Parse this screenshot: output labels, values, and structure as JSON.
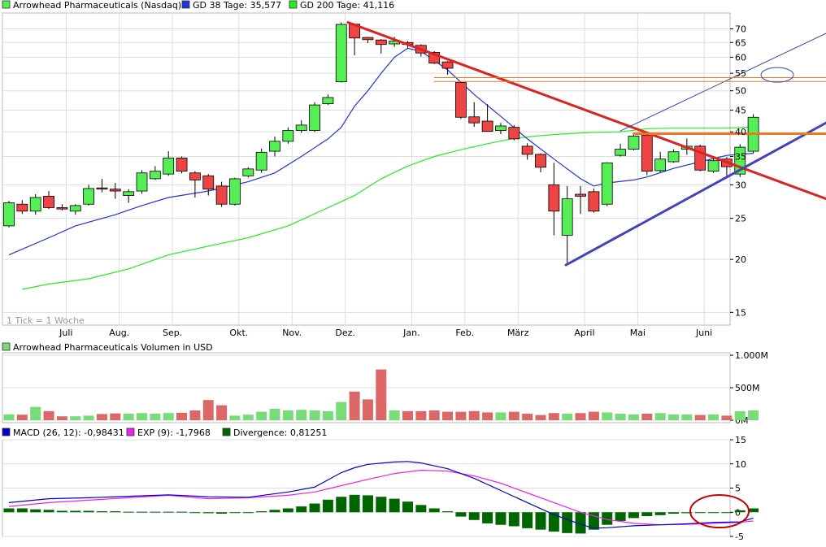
{
  "colors": {
    "up": "#55ee55",
    "down": "#ee4444",
    "gd38": "#2233dd",
    "gd200": "#22ee22",
    "grid": "#dddddd",
    "resistance": "#dd2222",
    "support": "#4444bb",
    "horizontal": "#ee7722",
    "channel": "#3344bb",
    "volume_up": "#77dd77",
    "volume_down": "#dd6666",
    "macd": "#0000cc",
    "exp": "#ee22ee",
    "divergence": "#006600",
    "highlight": "#cc0000"
  },
  "chart_data": [
    {
      "type": "candlestick",
      "legend": [
        {
          "label": "Arrowhead Pharmaceuticals (Nasdaq)",
          "color": "#55ee55"
        },
        {
          "label": "GD 38 Tage: 35,577",
          "color": "#2233dd"
        },
        {
          "label": "GD 200 Tage: 41,116",
          "color": "#22ee22"
        }
      ],
      "scale": "log",
      "ylim": [
        14.5,
        73
      ],
      "y_ticks": [
        15,
        20,
        25,
        30,
        35,
        40,
        45,
        50,
        55,
        60,
        65,
        70
      ],
      "x_labels": [
        "Juli",
        "Aug.",
        "Sep.",
        "Okt.",
        "Nov.",
        "Dez.",
        "Jan.",
        "Feb.",
        "März",
        "April",
        "Mai",
        "Juni"
      ],
      "x_label_weeks": [
        4.3,
        8.3,
        12.3,
        17.3,
        21.3,
        25.3,
        30.3,
        34.3,
        38.3,
        43.3,
        47.3,
        52.3
      ],
      "note": "1 Tick = 1 Woche",
      "candles": [
        {
          "o": 24.0,
          "h": 27.5,
          "l": 23.8,
          "c": 27.2
        },
        {
          "o": 27.0,
          "h": 27.6,
          "l": 25.6,
          "c": 26.0
        },
        {
          "o": 26.0,
          "h": 28.5,
          "l": 25.5,
          "c": 28.0
        },
        {
          "o": 28.2,
          "h": 29.0,
          "l": 26.3,
          "c": 26.5
        },
        {
          "o": 26.5,
          "h": 27.0,
          "l": 26.1,
          "c": 26.3
        },
        {
          "o": 26.0,
          "h": 27.0,
          "l": 25.5,
          "c": 26.8
        },
        {
          "o": 27.0,
          "h": 30.0,
          "l": 26.8,
          "c": 29.4
        },
        {
          "o": 29.5,
          "h": 31.0,
          "l": 28.8,
          "c": 29.3
        },
        {
          "o": 29.3,
          "h": 30.3,
          "l": 27.8,
          "c": 29.0
        },
        {
          "o": 28.3,
          "h": 29.3,
          "l": 27.2,
          "c": 28.9
        },
        {
          "o": 29.0,
          "h": 32.5,
          "l": 28.6,
          "c": 32.0
        },
        {
          "o": 31.0,
          "h": 33.2,
          "l": 30.8,
          "c": 32.3
        },
        {
          "o": 31.8,
          "h": 36.0,
          "l": 31.5,
          "c": 34.7
        },
        {
          "o": 34.7,
          "h": 35.0,
          "l": 31.9,
          "c": 32.3
        },
        {
          "o": 32.0,
          "h": 32.3,
          "l": 28.0,
          "c": 30.8
        },
        {
          "o": 31.5,
          "h": 31.8,
          "l": 28.3,
          "c": 29.3
        },
        {
          "o": 29.8,
          "h": 30.5,
          "l": 26.6,
          "c": 27.0
        },
        {
          "o": 27.0,
          "h": 31.2,
          "l": 26.8,
          "c": 31.0
        },
        {
          "o": 31.5,
          "h": 33.0,
          "l": 31.2,
          "c": 32.7
        },
        {
          "o": 32.5,
          "h": 36.5,
          "l": 32.0,
          "c": 35.8
        },
        {
          "o": 36.0,
          "h": 39.0,
          "l": 35.0,
          "c": 38.0
        },
        {
          "o": 38.0,
          "h": 41.0,
          "l": 37.5,
          "c": 40.3
        },
        {
          "o": 40.3,
          "h": 42.6,
          "l": 39.8,
          "c": 41.5
        },
        {
          "o": 40.3,
          "h": 47.0,
          "l": 40.0,
          "c": 46.3
        },
        {
          "o": 46.6,
          "h": 49.0,
          "l": 46.3,
          "c": 48.2
        },
        {
          "o": 52.5,
          "h": 72.5,
          "l": 52.3,
          "c": 71.7
        },
        {
          "o": 71.8,
          "h": 72.0,
          "l": 60.6,
          "c": 66.6
        },
        {
          "o": 66.8,
          "h": 67.0,
          "l": 64.8,
          "c": 66.0
        },
        {
          "o": 65.9,
          "h": 66.2,
          "l": 61.2,
          "c": 64.3
        },
        {
          "o": 64.5,
          "h": 67.0,
          "l": 63.5,
          "c": 65.5
        },
        {
          "o": 65.0,
          "h": 65.5,
          "l": 62.8,
          "c": 64.3
        },
        {
          "o": 64.0,
          "h": 64.4,
          "l": 60.2,
          "c": 61.4
        },
        {
          "o": 61.6,
          "h": 62.0,
          "l": 57.8,
          "c": 58.1
        },
        {
          "o": 58.5,
          "h": 58.8,
          "l": 54.5,
          "c": 56.5
        },
        {
          "o": 52.3,
          "h": 52.5,
          "l": 42.9,
          "c": 43.3
        },
        {
          "o": 43.4,
          "h": 47.0,
          "l": 41.1,
          "c": 42.0
        },
        {
          "o": 42.4,
          "h": 46.5,
          "l": 40.1,
          "c": 40.1
        },
        {
          "o": 40.3,
          "h": 42.0,
          "l": 39.5,
          "c": 41.3
        },
        {
          "o": 41.0,
          "h": 41.5,
          "l": 38.2,
          "c": 38.5
        },
        {
          "o": 37.0,
          "h": 37.6,
          "l": 34.4,
          "c": 35.4
        },
        {
          "o": 35.4,
          "h": 35.6,
          "l": 32.1,
          "c": 33.0
        },
        {
          "o": 30.0,
          "h": 33.8,
          "l": 22.8,
          "c": 26.0
        },
        {
          "o": 22.8,
          "h": 29.8,
          "l": 19.6,
          "c": 27.8
        },
        {
          "o": 28.5,
          "h": 29.8,
          "l": 25.6,
          "c": 28.2
        },
        {
          "o": 28.9,
          "h": 29.4,
          "l": 25.8,
          "c": 26.0
        },
        {
          "o": 27.0,
          "h": 33.9,
          "l": 26.7,
          "c": 33.8
        },
        {
          "o": 35.2,
          "h": 37.5,
          "l": 35.0,
          "c": 36.4
        },
        {
          "o": 36.4,
          "h": 39.8,
          "l": 36.2,
          "c": 39.1
        },
        {
          "o": 39.3,
          "h": 39.6,
          "l": 31.6,
          "c": 32.3
        },
        {
          "o": 32.4,
          "h": 35.9,
          "l": 32.1,
          "c": 34.5
        },
        {
          "o": 34.0,
          "h": 36.4,
          "l": 33.8,
          "c": 35.9
        },
        {
          "o": 36.4,
          "h": 38.6,
          "l": 35.3,
          "c": 37.0
        },
        {
          "o": 37.0,
          "h": 37.3,
          "l": 32.3,
          "c": 32.5
        },
        {
          "o": 32.3,
          "h": 34.8,
          "l": 32.0,
          "c": 34.2
        },
        {
          "o": 34.5,
          "h": 34.9,
          "l": 31.3,
          "c": 33.1
        },
        {
          "o": 31.8,
          "h": 37.4,
          "l": 31.3,
          "c": 36.8
        },
        {
          "o": 36.0,
          "h": 44.0,
          "l": 35.6,
          "c": 43.3
        }
      ],
      "gd38": [
        [
          0,
          20.5
        ],
        [
          3,
          22.5
        ],
        [
          5,
          24.0
        ],
        [
          8,
          25.5
        ],
        [
          10,
          26.8
        ],
        [
          12,
          28.0
        ],
        [
          15,
          29.0
        ],
        [
          18,
          30.5
        ],
        [
          20,
          32.0
        ],
        [
          22,
          35.0
        ],
        [
          24,
          38.5
        ],
        [
          25,
          41.0
        ],
        [
          26,
          46.0
        ],
        [
          27,
          50.0
        ],
        [
          28,
          55.0
        ],
        [
          29,
          60.0
        ],
        [
          30,
          63.0
        ],
        [
          31,
          62.0
        ],
        [
          33,
          56.0
        ],
        [
          35,
          49.0
        ],
        [
          37,
          43.5
        ],
        [
          39,
          38.5
        ],
        [
          41,
          34.5
        ],
        [
          43,
          31.0
        ],
        [
          44,
          29.8
        ],
        [
          45,
          30.3
        ],
        [
          47,
          30.8
        ],
        [
          48,
          31.3
        ],
        [
          50,
          32.8
        ],
        [
          52,
          34.0
        ],
        [
          54,
          35.2
        ],
        [
          56,
          35.6
        ]
      ],
      "gd200": [
        [
          1,
          17.0
        ],
        [
          3,
          17.5
        ],
        [
          6,
          18.0
        ],
        [
          9,
          19.0
        ],
        [
          12,
          20.5
        ],
        [
          15,
          21.5
        ],
        [
          18,
          22.5
        ],
        [
          21,
          24.0
        ],
        [
          24,
          26.5
        ],
        [
          26,
          28.3
        ],
        [
          28,
          31.0
        ],
        [
          30,
          33.2
        ],
        [
          32,
          35.0
        ],
        [
          34,
          36.3
        ],
        [
          36,
          37.5
        ],
        [
          38,
          38.6
        ],
        [
          40,
          39.2
        ],
        [
          42,
          39.6
        ],
        [
          44,
          39.9
        ],
        [
          46,
          40.0
        ],
        [
          48,
          40.7
        ],
        [
          50,
          40.8
        ],
        [
          52,
          40.8
        ],
        [
          54,
          40.8
        ],
        [
          56,
          41.1
        ]
      ],
      "lines": [
        {
          "kind": "resistance",
          "from": [
            25.5,
            72.5
          ],
          "to": [
            61.6,
            27.8
          ]
        },
        {
          "kind": "support",
          "from": [
            41.9,
            19.4
          ],
          "to": [
            61.6,
            42.0
          ]
        },
        {
          "kind": "channel-upper",
          "from": [
            46.0,
            40.2
          ],
          "to": [
            61.6,
            68.3
          ]
        },
        {
          "kind": "horizontal",
          "from": [
            32.0,
            52.6
          ],
          "to": [
            61.6,
            52.6
          ]
        },
        {
          "kind": "horizontal",
          "from": [
            32.0,
            53.7
          ],
          "to": [
            61.6,
            53.7
          ]
        },
        {
          "kind": "horizontal-bold",
          "from": [
            47.0,
            39.6
          ],
          "to": [
            61.6,
            39.6
          ]
        }
      ]
    },
    {
      "type": "bar",
      "legend": [
        {
          "label": "Arrowhead Pharmaceuticals Volumen in USD",
          "color": "#77dd77"
        }
      ],
      "unit": "M",
      "ylim": [
        0,
        1000
      ],
      "y_ticks": [
        "1.000M",
        "500M",
        "0M"
      ],
      "y_tick_values": [
        1000,
        500,
        0
      ],
      "values": [
        90,
        85,
        205,
        140,
        60,
        60,
        70,
        95,
        105,
        100,
        110,
        100,
        110,
        115,
        150,
        310,
        230,
        70,
        85,
        130,
        175,
        150,
        160,
        150,
        140,
        280,
        440,
        320,
        780,
        150,
        140,
        140,
        150,
        130,
        130,
        140,
        120,
        120,
        130,
        100,
        80,
        110,
        100,
        110,
        130,
        120,
        100,
        90,
        100,
        110,
        90,
        90,
        80,
        90,
        70,
        140,
        150
      ]
    },
    {
      "type": "macd",
      "legend": [
        {
          "label": "MACD (26, 12): -0,98431",
          "color": "#0000cc"
        },
        {
          "label": "EXP (9): -1,7968",
          "color": "#ee22ee"
        },
        {
          "label": "Divergence: 0,81251",
          "color": "#006600"
        }
      ],
      "ylim": [
        -5,
        15
      ],
      "y_ticks": [
        15,
        10,
        5,
        0,
        -5
      ],
      "macd": [
        [
          0,
          2.0
        ],
        [
          3,
          2.8
        ],
        [
          6,
          3.0
        ],
        [
          9,
          3.3
        ],
        [
          12,
          3.6
        ],
        [
          15,
          3.2
        ],
        [
          18,
          3.1
        ],
        [
          21,
          4.2
        ],
        [
          23,
          5.2
        ],
        [
          25,
          8.2
        ],
        [
          26,
          9.2
        ],
        [
          27,
          9.9
        ],
        [
          29,
          10.4
        ],
        [
          30,
          10.5
        ],
        [
          31,
          10.2
        ],
        [
          33,
          9.0
        ],
        [
          35,
          7.0
        ],
        [
          37,
          4.5
        ],
        [
          39,
          2.0
        ],
        [
          41,
          -0.5
        ],
        [
          43,
          -2.5
        ],
        [
          44,
          -3.3
        ],
        [
          45,
          -3.2
        ],
        [
          47,
          -2.8
        ],
        [
          49,
          -2.6
        ],
        [
          51,
          -2.4
        ],
        [
          53,
          -2.1
        ],
        [
          55,
          -2.0
        ],
        [
          56,
          -1.2
        ]
      ],
      "exp": [
        [
          0,
          1.2
        ],
        [
          3,
          2.0
        ],
        [
          6,
          2.5
        ],
        [
          9,
          3.0
        ],
        [
          12,
          3.5
        ],
        [
          15,
          2.8
        ],
        [
          18,
          3.0
        ],
        [
          21,
          3.5
        ],
        [
          23,
          4.2
        ],
        [
          25,
          5.5
        ],
        [
          27,
          6.8
        ],
        [
          29,
          8.0
        ],
        [
          31,
          8.7
        ],
        [
          33,
          8.5
        ],
        [
          35,
          7.5
        ],
        [
          37,
          6.0
        ],
        [
          39,
          4.0
        ],
        [
          41,
          2.0
        ],
        [
          43,
          0.0
        ],
        [
          45,
          -1.5
        ],
        [
          47,
          -2.3
        ],
        [
          49,
          -2.6
        ],
        [
          51,
          -2.5
        ],
        [
          53,
          -2.3
        ],
        [
          55,
          -2.1
        ],
        [
          56,
          -1.8
        ]
      ],
      "divergence": [
        0.8,
        0.8,
        0.6,
        0.5,
        0.3,
        0.3,
        0.3,
        0.2,
        0.2,
        0.1,
        0.1,
        0.1,
        0.1,
        0.1,
        0.0,
        -0.2,
        -0.3,
        -0.1,
        0.0,
        0.2,
        0.5,
        0.8,
        1.2,
        1.8,
        2.6,
        3.2,
        3.6,
        3.5,
        3.2,
        2.8,
        2.2,
        1.5,
        0.8,
        0.2,
        -0.9,
        -1.6,
        -2.3,
        -2.6,
        -2.9,
        -3.3,
        -3.6,
        -4.0,
        -4.3,
        -4.4,
        -3.6,
        -2.6,
        -1.8,
        -1.2,
        -0.8,
        -0.6,
        -0.3,
        -0.2,
        -0.1,
        0.0,
        0.0,
        0.4,
        0.8
      ]
    }
  ]
}
